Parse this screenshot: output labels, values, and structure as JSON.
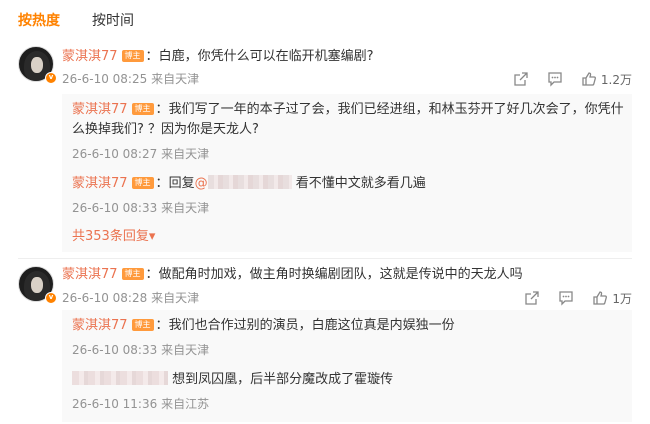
{
  "tabs": [
    {
      "label": "按热度",
      "active": true
    },
    {
      "label": "按时间",
      "active": false
    }
  ],
  "comments": [
    {
      "author": "蒙淇淇77",
      "badge": "博主",
      "text": "白鹿，你凭什么可以在临开机塞编剧?",
      "time": "26-6-10 08:25",
      "source": "来自天津",
      "likes": "1.2万",
      "replies": [
        {
          "author": "蒙淇淇77",
          "badge": "博主",
          "text": "我们写了一年的本子过了会，我们已经进组，和林玉芬开了好几次会了，你凭什么换掉我们? ？因为你是天龙人?",
          "time": "26-6-10 08:27",
          "source": "来自天津"
        },
        {
          "author": "蒙淇淇77",
          "badge": "博主",
          "prefix": "回复",
          "mention": "@",
          "text": "看不懂中文就多看几遍",
          "time": "26-6-10 08:33",
          "source": "来自天津"
        }
      ],
      "more_replies": "共353条回复"
    },
    {
      "author": "蒙淇淇77",
      "badge": "博主",
      "text": "做配角时加戏，做主角时换编剧团队，这就是传说中的天龙人吗",
      "time": "26-6-10 08:28",
      "source": "来自天津",
      "likes": "1万",
      "replies": [
        {
          "author": "蒙淇淇77",
          "badge": "博主",
          "text": "我们也合作过别的演员，白鹿这位真是内娱独一份",
          "time": "26-6-10 08:33",
          "source": "来自天津"
        },
        {
          "text": "想到凤囚凰，后半部分魔改成了霍璇传",
          "time": "26-6-10 11:36",
          "source": "来自江苏"
        }
      ]
    }
  ],
  "colors": {
    "accent": "#ff8200",
    "username": "#eb7350",
    "meta": "#939393"
  },
  "icons": [
    "share-icon",
    "comment-icon",
    "like-icon",
    "verified-badge-icon"
  ]
}
